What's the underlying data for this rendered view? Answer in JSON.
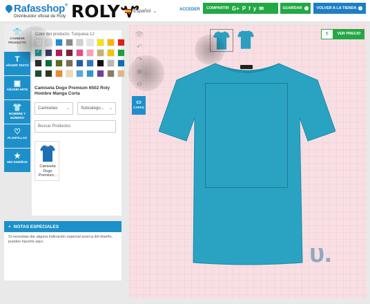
{
  "header": {
    "logo_text": "Rafasshop",
    "logo_tm": "®",
    "logo_subtitle": "Distribuidor oficial de Roly",
    "brand": "ROLY",
    "language": "Español",
    "login": "ACCEDER",
    "share_label": "COMPARTIR",
    "share_icons": [
      "G+",
      "P",
      "f",
      "y",
      "✉"
    ],
    "save_label": "GUARDAR",
    "back_label": "VOLVER A LA TIENDA"
  },
  "tools": [
    {
      "label": "CAMBIAR PRODUCTO",
      "icon": "tshirt-icon"
    },
    {
      "label": "AÑADIR TEXTO",
      "icon": "text-icon"
    },
    {
      "label": "AÑADIR ARTE",
      "icon": "image-icon"
    },
    {
      "label": "NOMBRE Y NÚMERO",
      "icon": "tshirt-number-icon"
    },
    {
      "label": "PLANTILLAS",
      "icon": "heart-icon"
    },
    {
      "label": "MIS DISEÑOS",
      "icon": "star-icon"
    }
  ],
  "product": {
    "color_label": "Color del producto: Turquesa 12",
    "name": "Camiseta Dogo Premium 6502 Roly Hombre Manga Corta",
    "category_select": "Camisetas",
    "subcategory_select": "Subcatego...",
    "search_placeholder": "Buscar Productos",
    "card_label": "Camiseta Dogo Premium..."
  },
  "swatch_colors": [
    "#ffffff",
    "#eaeaea",
    "#1d90c9",
    "#8a8a8a",
    "#cfcfcf",
    "#e6e6e6",
    "#f7e200",
    "#ffb400",
    "#e21d1d",
    "#1aa3a3",
    "#3c3c6e",
    "#b01a55",
    "#7a1f3d",
    "#e84a8a",
    "#f5a3b8",
    "#c7b36b",
    "#f4c400",
    "#1f9e3c",
    "#2c2c2c",
    "#0f6a3a",
    "#5f6b1e",
    "#7e6a55",
    "#1d5fa8",
    "#2c7abf",
    "#111111",
    "#b8b8b8",
    "#0b6fb3",
    "#1a4f2a",
    "#2b3a1c",
    "#e98a2b",
    "#f2d9b0",
    "#5ba8d6",
    "#2e96d8",
    "#6d3fa0",
    "#8a7b66",
    "#d9b98a"
  ],
  "notes": {
    "title": "NOTAS ESPECIALES",
    "text": "Si necesitas dar alguna indicación especial acerca del diseño, puedes hacerlo aquí."
  },
  "canvas": {
    "capas_label": "CAPAS",
    "price_symbol": "€",
    "price_label": "VER PRECIO",
    "shirt_color": "#2aa3c2"
  }
}
